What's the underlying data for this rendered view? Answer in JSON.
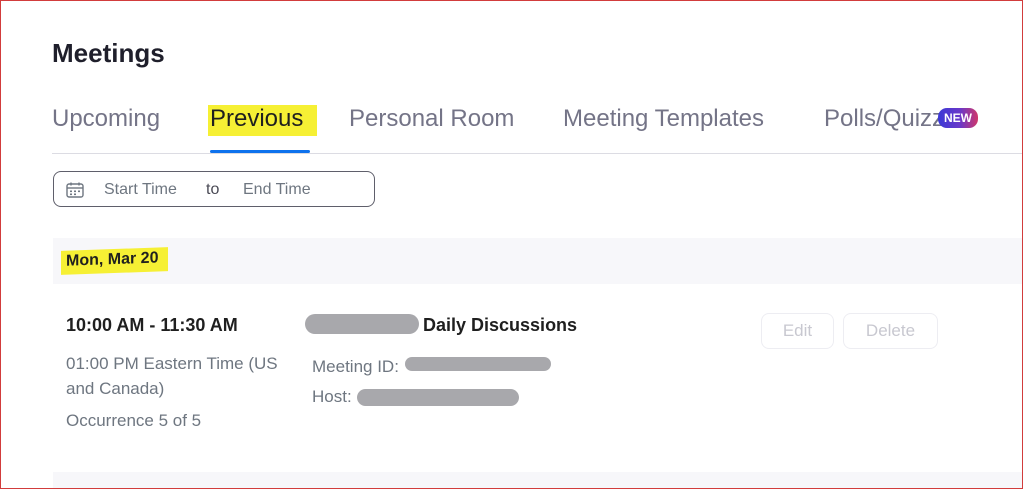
{
  "page": {
    "title": "Meetings"
  },
  "tabs": [
    {
      "label": "Upcoming",
      "active": false
    },
    {
      "label": "Previous",
      "active": true
    },
    {
      "label": "Personal Room",
      "active": false
    },
    {
      "label": "Meeting Templates",
      "active": false
    },
    {
      "label": "Polls/Quizzes",
      "active": false,
      "badge": "NEW"
    }
  ],
  "date_filter": {
    "start_placeholder": "Start Time",
    "separator": "to",
    "end_placeholder": "End Time"
  },
  "day_group": {
    "label": "Mon, Mar 20",
    "meeting": {
      "time": "10:00 AM - 11:30 AM",
      "timezone": "01:00 PM Eastern Time (US and Canada)",
      "occurrence": "Occurrence 5 of 5",
      "topic_visible": "Daily Discussions",
      "meeting_id_label": "Meeting ID:",
      "host_label": "Host:",
      "edit_label": "Edit",
      "delete_label": "Delete"
    }
  },
  "colors": {
    "accent": "#0e72ed",
    "highlight": "#f6f034"
  }
}
